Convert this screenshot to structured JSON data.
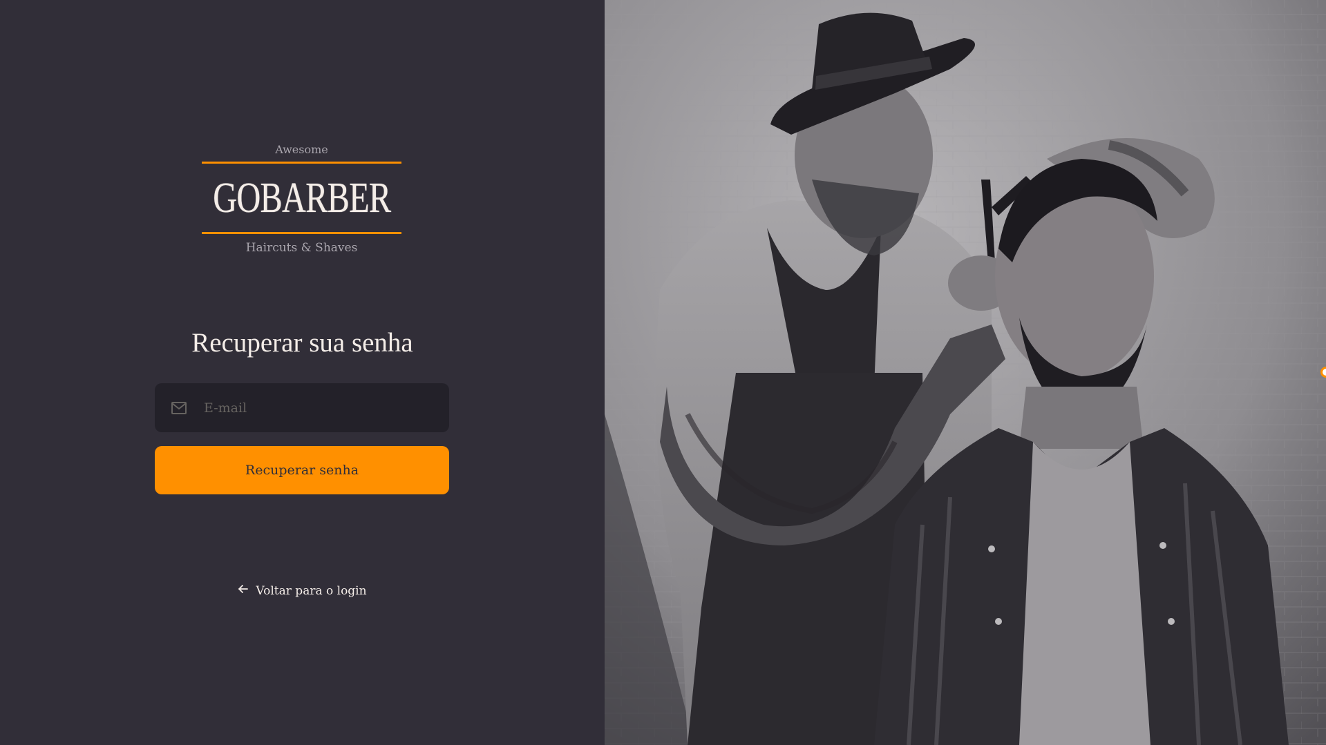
{
  "logo": {
    "top_text": "Awesome",
    "brand": "GOBARBER",
    "bottom_text": "Haircuts & Shaves"
  },
  "form": {
    "title": "Recuperar sua senha",
    "email_placeholder": "E-mail",
    "email_value": "",
    "submit_label": "Recuperar senha"
  },
  "back_link": {
    "label": "Voltar para o login"
  },
  "icons": {
    "email": "mail-icon",
    "back": "arrow-left-icon"
  },
  "colors": {
    "background": "#312e38",
    "input_bg": "#232129",
    "accent": "#ff9000",
    "text": "#f4ede8",
    "placeholder": "#666360"
  }
}
